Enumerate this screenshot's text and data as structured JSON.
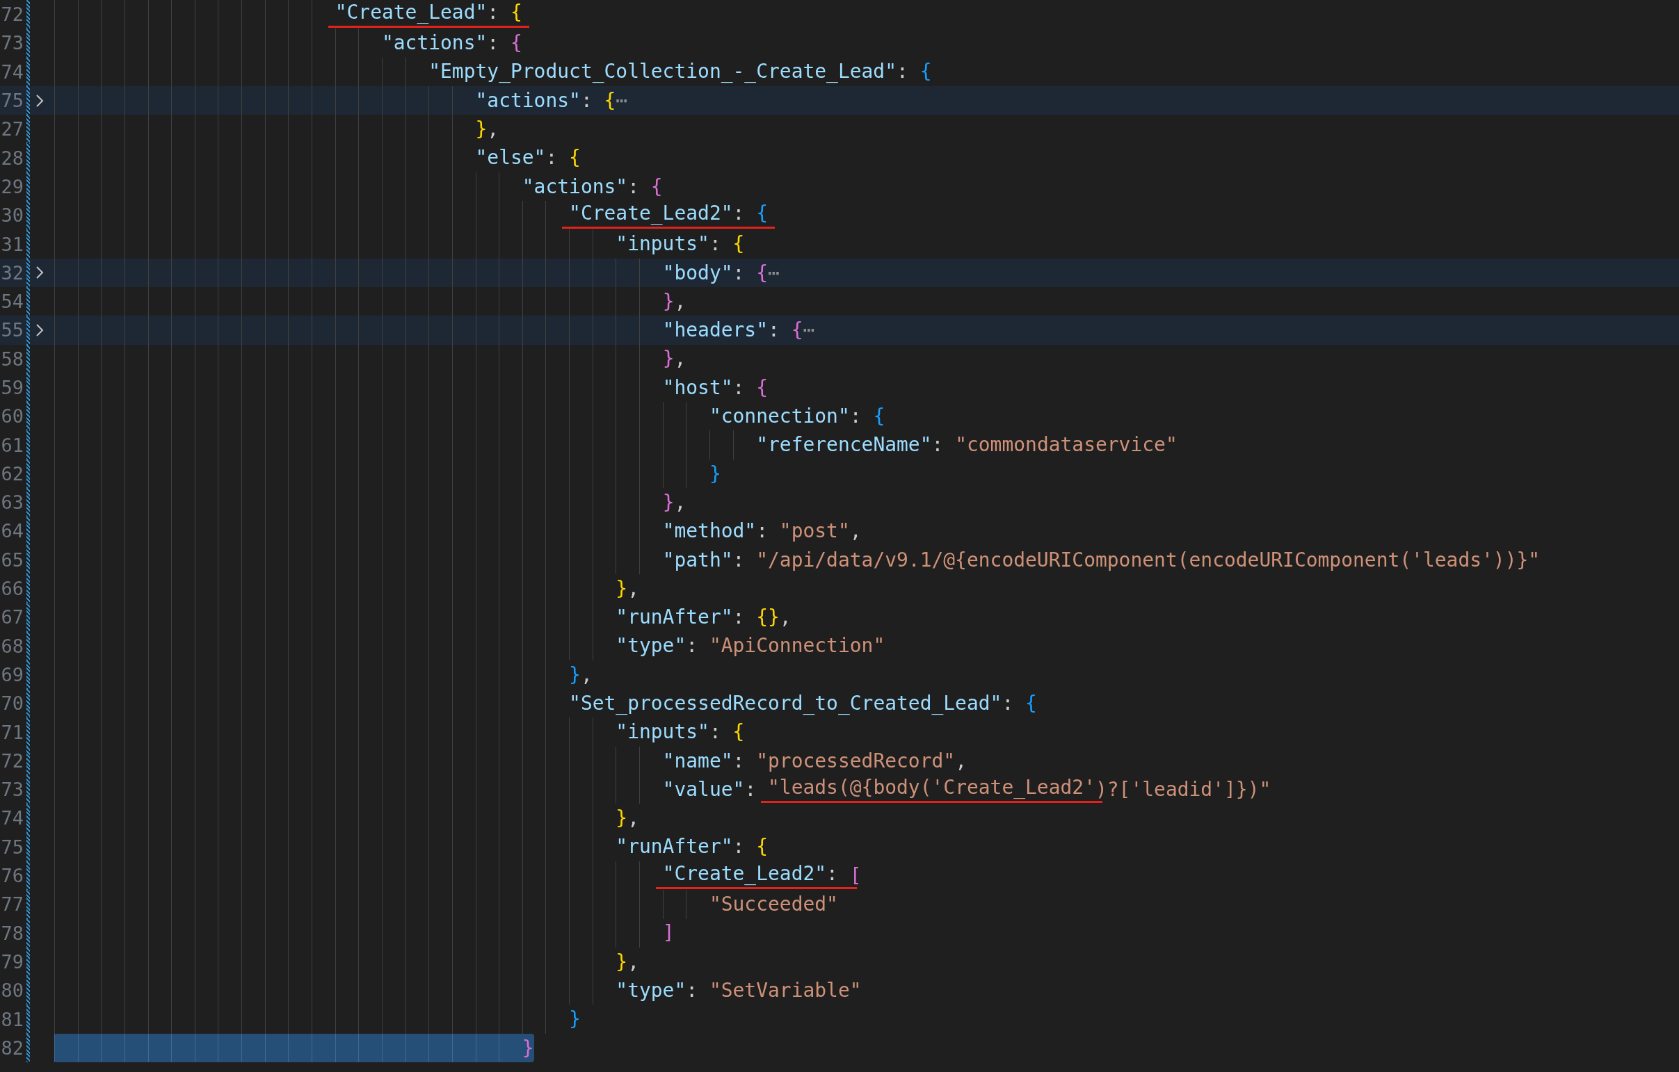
{
  "editor": {
    "lines": [
      {
        "number": "72",
        "folded": false,
        "selected": false,
        "tokens": [
          {
            "kind": "underline",
            "tokens": [
              {
                "kind": "key",
                "text": "\"Create_Lead\""
              },
              {
                "kind": "punct",
                "text": ": "
              },
              {
                "kind": "b1",
                "text": "{"
              }
            ]
          }
        ],
        "children": [
          {
            "number": "73",
            "folded": false,
            "selected": false,
            "tokens": [
              {
                "kind": "key",
                "text": "\"actions\""
              },
              {
                "kind": "punct",
                "text": ": "
              },
              {
                "kind": "b2",
                "text": "{"
              }
            ],
            "children": [
              {
                "number": "74",
                "folded": false,
                "selected": false,
                "tokens": [
                  {
                    "kind": "key",
                    "text": "\"Empty_Product_Collection_-_Create_Lead\""
                  },
                  {
                    "kind": "punct",
                    "text": ": "
                  },
                  {
                    "kind": "b3",
                    "text": "{"
                  }
                ],
                "children": [
                  {
                    "number": "75",
                    "folded": true,
                    "selected": false,
                    "tokens": [
                      {
                        "kind": "key",
                        "text": "\"actions\""
                      },
                      {
                        "kind": "punct",
                        "text": ": "
                      },
                      {
                        "kind": "b1",
                        "text": "{"
                      },
                      {
                        "kind": "ellipsis",
                        "text": "⋯"
                      }
                    ]
                  },
                  {
                    "number": "27",
                    "folded": false,
                    "selected": false,
                    "tokens": [
                      {
                        "kind": "b1",
                        "text": "}"
                      },
                      {
                        "kind": "punct",
                        "text": ","
                      }
                    ]
                  },
                  {
                    "number": "28",
                    "folded": false,
                    "selected": false,
                    "tokens": [
                      {
                        "kind": "key",
                        "text": "\"else\""
                      },
                      {
                        "kind": "punct",
                        "text": ": "
                      },
                      {
                        "kind": "b1",
                        "text": "{"
                      }
                    ],
                    "children": [
                      {
                        "number": "29",
                        "folded": false,
                        "selected": false,
                        "tokens": [
                          {
                            "kind": "key",
                            "text": "\"actions\""
                          },
                          {
                            "kind": "punct",
                            "text": ": "
                          },
                          {
                            "kind": "b2",
                            "text": "{"
                          }
                        ],
                        "children": [
                          {
                            "number": "30",
                            "folded": false,
                            "selected": false,
                            "tokens": [
                              {
                                "kind": "underline",
                                "tokens": [
                                  {
                                    "kind": "key",
                                    "text": "\"Create_Lead2\""
                                  },
                                  {
                                    "kind": "punct",
                                    "text": ": "
                                  },
                                  {
                                    "kind": "b3",
                                    "text": "{"
                                  }
                                ]
                              }
                            ],
                            "children": [
                              {
                                "number": "31",
                                "folded": false,
                                "selected": false,
                                "tokens": [
                                  {
                                    "kind": "key",
                                    "text": "\"inputs\""
                                  },
                                  {
                                    "kind": "punct",
                                    "text": ": "
                                  },
                                  {
                                    "kind": "b1",
                                    "text": "{"
                                  }
                                ],
                                "children": [
                                  {
                                    "number": "32",
                                    "folded": true,
                                    "selected": false,
                                    "tokens": [
                                      {
                                        "kind": "key",
                                        "text": "\"body\""
                                      },
                                      {
                                        "kind": "punct",
                                        "text": ": "
                                      },
                                      {
                                        "kind": "b2",
                                        "text": "{"
                                      },
                                      {
                                        "kind": "ellipsis",
                                        "text": "⋯"
                                      }
                                    ]
                                  },
                                  {
                                    "number": "54",
                                    "folded": false,
                                    "selected": false,
                                    "tokens": [
                                      {
                                        "kind": "b2",
                                        "text": "}"
                                      },
                                      {
                                        "kind": "punct",
                                        "text": ","
                                      }
                                    ]
                                  },
                                  {
                                    "number": "55",
                                    "folded": true,
                                    "selected": false,
                                    "tokens": [
                                      {
                                        "kind": "key",
                                        "text": "\"headers\""
                                      },
                                      {
                                        "kind": "punct",
                                        "text": ": "
                                      },
                                      {
                                        "kind": "b2",
                                        "text": "{"
                                      },
                                      {
                                        "kind": "ellipsis",
                                        "text": "⋯"
                                      }
                                    ]
                                  },
                                  {
                                    "number": "58",
                                    "folded": false,
                                    "selected": false,
                                    "tokens": [
                                      {
                                        "kind": "b2",
                                        "text": "}"
                                      },
                                      {
                                        "kind": "punct",
                                        "text": ","
                                      }
                                    ]
                                  },
                                  {
                                    "number": "59",
                                    "folded": false,
                                    "selected": false,
                                    "tokens": [
                                      {
                                        "kind": "key",
                                        "text": "\"host\""
                                      },
                                      {
                                        "kind": "punct",
                                        "text": ": "
                                      },
                                      {
                                        "kind": "b2",
                                        "text": "{"
                                      }
                                    ],
                                    "children": [
                                      {
                                        "number": "60",
                                        "folded": false,
                                        "selected": false,
                                        "tokens": [
                                          {
                                            "kind": "key",
                                            "text": "\"connection\""
                                          },
                                          {
                                            "kind": "punct",
                                            "text": ": "
                                          },
                                          {
                                            "kind": "b3",
                                            "text": "{"
                                          }
                                        ],
                                        "children": [
                                          {
                                            "number": "61",
                                            "folded": false,
                                            "selected": false,
                                            "tokens": [
                                              {
                                                "kind": "key",
                                                "text": "\"referenceName\""
                                              },
                                              {
                                                "kind": "punct",
                                                "text": ": "
                                              },
                                              {
                                                "kind": "str",
                                                "text": "\"commondataservice\""
                                              }
                                            ]
                                          }
                                        ]
                                      },
                                      {
                                        "number": "62",
                                        "folded": false,
                                        "selected": false,
                                        "tokens": [
                                          {
                                            "kind": "b3",
                                            "text": "}"
                                          }
                                        ]
                                      }
                                    ]
                                  },
                                  {
                                    "number": "63",
                                    "folded": false,
                                    "selected": false,
                                    "tokens": [
                                      {
                                        "kind": "b2",
                                        "text": "}"
                                      },
                                      {
                                        "kind": "punct",
                                        "text": ","
                                      }
                                    ]
                                  },
                                  {
                                    "number": "64",
                                    "folded": false,
                                    "selected": false,
                                    "tokens": [
                                      {
                                        "kind": "key",
                                        "text": "\"method\""
                                      },
                                      {
                                        "kind": "punct",
                                        "text": ": "
                                      },
                                      {
                                        "kind": "str",
                                        "text": "\"post\""
                                      },
                                      {
                                        "kind": "punct",
                                        "text": ","
                                      }
                                    ]
                                  },
                                  {
                                    "number": "65",
                                    "folded": false,
                                    "selected": false,
                                    "tokens": [
                                      {
                                        "kind": "key",
                                        "text": "\"path\""
                                      },
                                      {
                                        "kind": "punct",
                                        "text": ": "
                                      },
                                      {
                                        "kind": "str",
                                        "text": "\"/api/data/v9.1/@{encodeURIComponent(encodeURIComponent('leads'))}\""
                                      }
                                    ]
                                  }
                                ]
                              },
                              {
                                "number": "66",
                                "folded": false,
                                "selected": false,
                                "tokens": [
                                  {
                                    "kind": "b1",
                                    "text": "}"
                                  },
                                  {
                                    "kind": "punct",
                                    "text": ","
                                  }
                                ]
                              },
                              {
                                "number": "67",
                                "folded": false,
                                "selected": false,
                                "tokens": [
                                  {
                                    "kind": "key",
                                    "text": "\"runAfter\""
                                  },
                                  {
                                    "kind": "punct",
                                    "text": ": "
                                  },
                                  {
                                    "kind": "b1",
                                    "text": "{}"
                                  },
                                  {
                                    "kind": "punct",
                                    "text": ","
                                  }
                                ]
                              },
                              {
                                "number": "68",
                                "folded": false,
                                "selected": false,
                                "tokens": [
                                  {
                                    "kind": "key",
                                    "text": "\"type\""
                                  },
                                  {
                                    "kind": "punct",
                                    "text": ": "
                                  },
                                  {
                                    "kind": "str",
                                    "text": "\"ApiConnection\""
                                  }
                                ]
                              }
                            ]
                          },
                          {
                            "number": "69",
                            "folded": false,
                            "selected": false,
                            "tokens": [
                              {
                                "kind": "b3",
                                "text": "}"
                              },
                              {
                                "kind": "punct",
                                "text": ","
                              }
                            ]
                          },
                          {
                            "number": "70",
                            "folded": false,
                            "selected": false,
                            "tokens": [
                              {
                                "kind": "key",
                                "text": "\"Set_processedRecord_to_Created_Lead\""
                              },
                              {
                                "kind": "punct",
                                "text": ": "
                              },
                              {
                                "kind": "b3",
                                "text": "{"
                              }
                            ],
                            "children": [
                              {
                                "number": "71",
                                "folded": false,
                                "selected": false,
                                "tokens": [
                                  {
                                    "kind": "key",
                                    "text": "\"inputs\""
                                  },
                                  {
                                    "kind": "punct",
                                    "text": ": "
                                  },
                                  {
                                    "kind": "b1",
                                    "text": "{"
                                  }
                                ],
                                "children": [
                                  {
                                    "number": "72",
                                    "folded": false,
                                    "selected": false,
                                    "tokens": [
                                      {
                                        "kind": "key",
                                        "text": "\"name\""
                                      },
                                      {
                                        "kind": "punct",
                                        "text": ": "
                                      },
                                      {
                                        "kind": "str",
                                        "text": "\"processedRecord\""
                                      },
                                      {
                                        "kind": "punct",
                                        "text": ","
                                      }
                                    ]
                                  },
                                  {
                                    "number": "73",
                                    "folded": false,
                                    "selected": false,
                                    "tokens": [
                                      {
                                        "kind": "key",
                                        "text": "\"value\""
                                      },
                                      {
                                        "kind": "punct",
                                        "text": ": "
                                      },
                                      {
                                        "kind": "underline",
                                        "tokens": [
                                          {
                                            "kind": "str",
                                            "text": "\"leads(@{body('Create_Lead2'"
                                          }
                                        ]
                                      },
                                      {
                                        "kind": "str",
                                        "text": ")?['leadid']})\""
                                      }
                                    ]
                                  }
                                ]
                              },
                              {
                                "number": "74",
                                "folded": false,
                                "selected": false,
                                "tokens": [
                                  {
                                    "kind": "b1",
                                    "text": "}"
                                  },
                                  {
                                    "kind": "punct",
                                    "text": ","
                                  }
                                ]
                              },
                              {
                                "number": "75",
                                "folded": false,
                                "selected": false,
                                "tokens": [
                                  {
                                    "kind": "key",
                                    "text": "\"runAfter\""
                                  },
                                  {
                                    "kind": "punct",
                                    "text": ": "
                                  },
                                  {
                                    "kind": "b1",
                                    "text": "{"
                                  }
                                ],
                                "children": [
                                  {
                                    "number": "76",
                                    "folded": false,
                                    "selected": false,
                                    "tokens": [
                                      {
                                        "kind": "underline",
                                        "tokens": [
                                          {
                                            "kind": "key",
                                            "text": "\"Create_Lead2\""
                                          },
                                          {
                                            "kind": "punct",
                                            "text": ": "
                                          }
                                        ]
                                      },
                                      {
                                        "kind": "b2",
                                        "text": "["
                                      }
                                    ],
                                    "children": [
                                      {
                                        "number": "77",
                                        "folded": false,
                                        "selected": false,
                                        "tokens": [
                                          {
                                            "kind": "str",
                                            "text": "\"Succeeded\""
                                          }
                                        ]
                                      }
                                    ]
                                  },
                                  {
                                    "number": "78",
                                    "folded": false,
                                    "selected": false,
                                    "tokens": [
                                      {
                                        "kind": "b2",
                                        "text": "]"
                                      }
                                    ]
                                  }
                                ]
                              },
                              {
                                "number": "79",
                                "folded": false,
                                "selected": false,
                                "tokens": [
                                  {
                                    "kind": "b1",
                                    "text": "}"
                                  },
                                  {
                                    "kind": "punct",
                                    "text": ","
                                  }
                                ]
                              },
                              {
                                "number": "80",
                                "folded": false,
                                "selected": false,
                                "tokens": [
                                  {
                                    "kind": "key",
                                    "text": "\"type\""
                                  },
                                  {
                                    "kind": "punct",
                                    "text": ": "
                                  },
                                  {
                                    "kind": "str",
                                    "text": "\"SetVariable\""
                                  }
                                ]
                              }
                            ]
                          },
                          {
                            "number": "81",
                            "folded": false,
                            "selected": false,
                            "tokens": [
                              {
                                "kind": "b3",
                                "text": "}"
                              }
                            ]
                          }
                        ]
                      },
                      {
                        "number": "82",
                        "folded": false,
                        "selected": true,
                        "tokens": [
                          {
                            "kind": "b2",
                            "text": "}"
                          }
                        ]
                      }
                    ]
                  }
                ]
              }
            ]
          }
        ]
      }
    ]
  }
}
